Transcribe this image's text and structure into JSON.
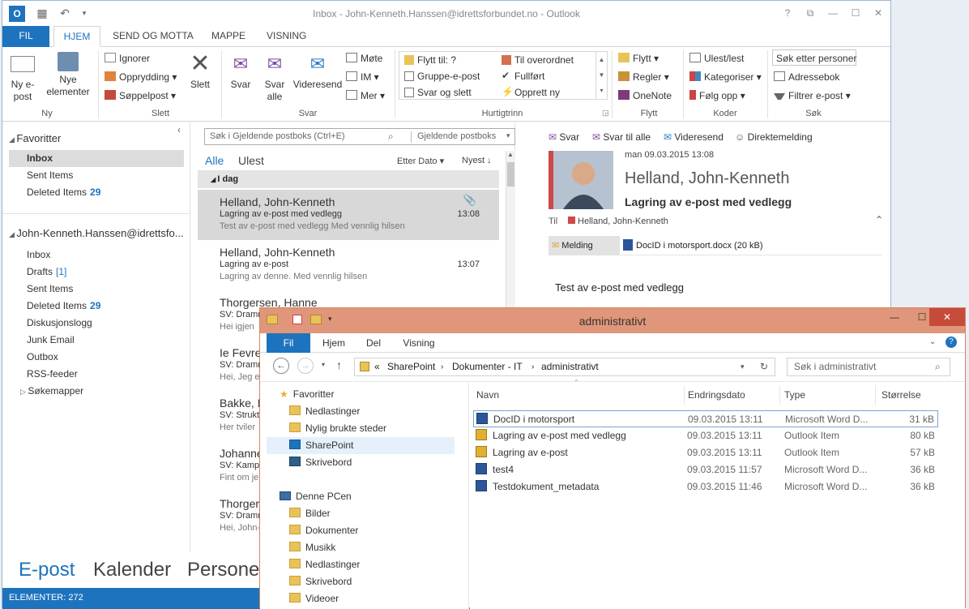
{
  "outlook": {
    "title": "Inbox - John-Kenneth.Hanssen@idrettsforbundet.no - Outlook",
    "window_controls": [
      "?",
      "⧉",
      "—",
      "☐",
      "✕"
    ],
    "tabs": [
      "FIL",
      "HJEM",
      "SEND OG MOTTA",
      "MAPPE",
      "VISNING"
    ],
    "active_tab": "HJEM",
    "ribbon": {
      "ny": {
        "new_email": "Ny e-post",
        "new_items": "Nye elementer",
        "label": "Ny"
      },
      "slett": {
        "ignorer": "Ignorer",
        "opprydding": "Opprydding",
        "soppelpost": "Søppelpost",
        "slett": "Slett",
        "label": "Slett"
      },
      "svar": {
        "svar": "Svar",
        "svar_alle": "Svar alle",
        "videresend": "Videresend",
        "mote": "Møte",
        "im": "IM",
        "mer": "Mer",
        "label": "Svar"
      },
      "hurtigtrinn": {
        "items": [
          "Flytt til: ?",
          "Til overordnet",
          "Gruppe-e-post",
          "Fullført",
          "Svar og slett",
          "Opprett ny"
        ],
        "label": "Hurtigtrinn"
      },
      "flytt": {
        "flytt": "Flytt",
        "regler": "Regler",
        "onenote": "OneNote",
        "label": "Flytt"
      },
      "koder": {
        "ulest": "Ulest/lest",
        "kategoriser": "Kategoriser",
        "folg_opp": "Følg opp",
        "label": "Koder"
      },
      "sok": {
        "sok_personer": "Søk etter personer",
        "adressebok": "Adressebok",
        "filtrer": "Filtrer e-post",
        "label": "Søk"
      }
    },
    "nav": {
      "favorites_header": "Favoritter",
      "favorites": [
        {
          "label": "Inbox",
          "count": ""
        },
        {
          "label": "Sent Items",
          "count": ""
        },
        {
          "label": "Deleted Items",
          "count": "29"
        }
      ],
      "account": "John-Kenneth.Hanssen@idrettsfo...",
      "folders": [
        {
          "label": "Inbox",
          "count": ""
        },
        {
          "label": "Drafts",
          "count": "[1]"
        },
        {
          "label": "Sent Items",
          "count": ""
        },
        {
          "label": "Deleted Items",
          "count": "29"
        },
        {
          "label": "Diskusjonslogg",
          "count": ""
        },
        {
          "label": "Junk Email",
          "count": ""
        },
        {
          "label": "Outbox",
          "count": ""
        },
        {
          "label": "RSS-feeder",
          "count": ""
        },
        {
          "label": "Søkemapper",
          "count": ""
        }
      ]
    },
    "list": {
      "search_placeholder": "Søk i Gjeldende postboks (Ctrl+E)",
      "scope": "Gjeldende postboks",
      "filter_all": "Alle",
      "filter_unread": "Ulest",
      "sort_by": "Etter Dato",
      "order": "Nyest",
      "group": "I dag",
      "messages": [
        {
          "from": "Helland, John-Kenneth",
          "subject": "Lagring av e-post med vedlegg",
          "preview": "Test av e-post med vedlegg  Med vennlig hilsen",
          "time": "13:08"
        },
        {
          "from": "Helland, John-Kenneth",
          "subject": "Lagring av e-post",
          "preview": "Lagring av denne.  Med vennlig hilsen",
          "time": "13:07"
        },
        {
          "from": "Thorgersen, Hanne",
          "subject": "SV: Dramn",
          "preview": "Hei igjen",
          "time": ""
        },
        {
          "from": "Ie Fevre",
          "subject": "SV: Dramn",
          "preview": "Hei, Jeg e",
          "time": ""
        },
        {
          "from": "Bakke, K",
          "subject": "SV: Strukt",
          "preview": "Her tviler",
          "time": ""
        },
        {
          "from": "Johanne",
          "subject": "SV: Kamps",
          "preview": "Fint om je",
          "time": ""
        },
        {
          "from": "Thorger",
          "subject": "SV: Dramn",
          "preview": "Hei, John-",
          "time": ""
        }
      ]
    },
    "reading": {
      "actions": [
        "Svar",
        "Svar til alle",
        "Videresend",
        "Direktemelding"
      ],
      "date": "man 09.03.2015 13:08",
      "sender": "Helland, John-Kenneth",
      "subject": "Lagring av e-post med vedlegg",
      "to_label": "Til",
      "to": "Helland, John-Kenneth",
      "message_tab": "Melding",
      "attachment": "DocID i motorsport.docx (20 kB)",
      "body": "Test av e-post med vedlegg"
    },
    "bottom_nav": [
      "E-post",
      "Kalender",
      "Personer"
    ],
    "status": "ELEMENTER: 272"
  },
  "explorer": {
    "title": "administrativt",
    "tabs": [
      "Fil",
      "Hjem",
      "Del",
      "Visning"
    ],
    "breadcrumb": [
      "SharePoint",
      "Dokumenter - IT",
      "administrativt"
    ],
    "crumb_prefix": "«",
    "search_placeholder": "Søk i administrativt",
    "nav": {
      "favorites_header": "Favoritter",
      "favorites": [
        "Nedlastinger",
        "Nylig brukte steder",
        "SharePoint",
        "Skrivebord"
      ],
      "pc_header": "Denne PCen",
      "pc": [
        "Bilder",
        "Dokumenter",
        "Musikk",
        "Nedlastinger",
        "Skrivebord",
        "Videoer"
      ]
    },
    "columns": [
      "Navn",
      "Endringsdato",
      "Type",
      "Størrelse"
    ],
    "files": [
      {
        "name": "DocID i motorsport",
        "date": "09.03.2015 13:11",
        "type": "Microsoft Word D...",
        "size": "31 kB"
      },
      {
        "name": "Lagring av e-post med vedlegg",
        "date": "09.03.2015 13:11",
        "type": "Outlook Item",
        "size": "80 kB"
      },
      {
        "name": "Lagring av e-post",
        "date": "09.03.2015 13:11",
        "type": "Outlook Item",
        "size": "57 kB"
      },
      {
        "name": "test4",
        "date": "09.03.2015 11:57",
        "type": "Microsoft Word D...",
        "size": "36 kB"
      },
      {
        "name": "Testdokument_metadata",
        "date": "09.03.2015 11:46",
        "type": "Microsoft Word D...",
        "size": "36 kB"
      }
    ]
  },
  "colors": {
    "accent": "#1e73be",
    "explorer_title": "#e0967a",
    "close_red": "#c74b3a"
  }
}
